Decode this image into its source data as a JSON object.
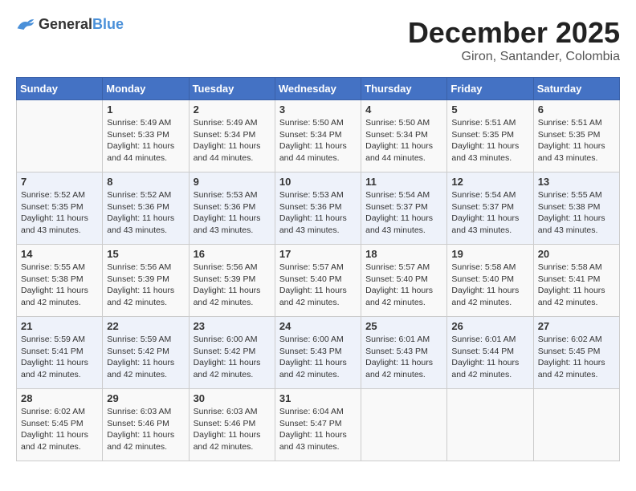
{
  "header": {
    "logo_general": "General",
    "logo_blue": "Blue",
    "month_year": "December 2025",
    "location": "Giron, Santander, Colombia"
  },
  "weekdays": [
    "Sunday",
    "Monday",
    "Tuesday",
    "Wednesday",
    "Thursday",
    "Friday",
    "Saturday"
  ],
  "weeks": [
    [
      {
        "day": "",
        "info": ""
      },
      {
        "day": "1",
        "info": "Sunrise: 5:49 AM\nSunset: 5:33 PM\nDaylight: 11 hours\nand 44 minutes."
      },
      {
        "day": "2",
        "info": "Sunrise: 5:49 AM\nSunset: 5:34 PM\nDaylight: 11 hours\nand 44 minutes."
      },
      {
        "day": "3",
        "info": "Sunrise: 5:50 AM\nSunset: 5:34 PM\nDaylight: 11 hours\nand 44 minutes."
      },
      {
        "day": "4",
        "info": "Sunrise: 5:50 AM\nSunset: 5:34 PM\nDaylight: 11 hours\nand 44 minutes."
      },
      {
        "day": "5",
        "info": "Sunrise: 5:51 AM\nSunset: 5:35 PM\nDaylight: 11 hours\nand 43 minutes."
      },
      {
        "day": "6",
        "info": "Sunrise: 5:51 AM\nSunset: 5:35 PM\nDaylight: 11 hours\nand 43 minutes."
      }
    ],
    [
      {
        "day": "7",
        "info": "Sunrise: 5:52 AM\nSunset: 5:35 PM\nDaylight: 11 hours\nand 43 minutes."
      },
      {
        "day": "8",
        "info": "Sunrise: 5:52 AM\nSunset: 5:36 PM\nDaylight: 11 hours\nand 43 minutes."
      },
      {
        "day": "9",
        "info": "Sunrise: 5:53 AM\nSunset: 5:36 PM\nDaylight: 11 hours\nand 43 minutes."
      },
      {
        "day": "10",
        "info": "Sunrise: 5:53 AM\nSunset: 5:36 PM\nDaylight: 11 hours\nand 43 minutes."
      },
      {
        "day": "11",
        "info": "Sunrise: 5:54 AM\nSunset: 5:37 PM\nDaylight: 11 hours\nand 43 minutes."
      },
      {
        "day": "12",
        "info": "Sunrise: 5:54 AM\nSunset: 5:37 PM\nDaylight: 11 hours\nand 43 minutes."
      },
      {
        "day": "13",
        "info": "Sunrise: 5:55 AM\nSunset: 5:38 PM\nDaylight: 11 hours\nand 43 minutes."
      }
    ],
    [
      {
        "day": "14",
        "info": "Sunrise: 5:55 AM\nSunset: 5:38 PM\nDaylight: 11 hours\nand 42 minutes."
      },
      {
        "day": "15",
        "info": "Sunrise: 5:56 AM\nSunset: 5:39 PM\nDaylight: 11 hours\nand 42 minutes."
      },
      {
        "day": "16",
        "info": "Sunrise: 5:56 AM\nSunset: 5:39 PM\nDaylight: 11 hours\nand 42 minutes."
      },
      {
        "day": "17",
        "info": "Sunrise: 5:57 AM\nSunset: 5:40 PM\nDaylight: 11 hours\nand 42 minutes."
      },
      {
        "day": "18",
        "info": "Sunrise: 5:57 AM\nSunset: 5:40 PM\nDaylight: 11 hours\nand 42 minutes."
      },
      {
        "day": "19",
        "info": "Sunrise: 5:58 AM\nSunset: 5:40 PM\nDaylight: 11 hours\nand 42 minutes."
      },
      {
        "day": "20",
        "info": "Sunrise: 5:58 AM\nSunset: 5:41 PM\nDaylight: 11 hours\nand 42 minutes."
      }
    ],
    [
      {
        "day": "21",
        "info": "Sunrise: 5:59 AM\nSunset: 5:41 PM\nDaylight: 11 hours\nand 42 minutes."
      },
      {
        "day": "22",
        "info": "Sunrise: 5:59 AM\nSunset: 5:42 PM\nDaylight: 11 hours\nand 42 minutes."
      },
      {
        "day": "23",
        "info": "Sunrise: 6:00 AM\nSunset: 5:42 PM\nDaylight: 11 hours\nand 42 minutes."
      },
      {
        "day": "24",
        "info": "Sunrise: 6:00 AM\nSunset: 5:43 PM\nDaylight: 11 hours\nand 42 minutes."
      },
      {
        "day": "25",
        "info": "Sunrise: 6:01 AM\nSunset: 5:43 PM\nDaylight: 11 hours\nand 42 minutes."
      },
      {
        "day": "26",
        "info": "Sunrise: 6:01 AM\nSunset: 5:44 PM\nDaylight: 11 hours\nand 42 minutes."
      },
      {
        "day": "27",
        "info": "Sunrise: 6:02 AM\nSunset: 5:45 PM\nDaylight: 11 hours\nand 42 minutes."
      }
    ],
    [
      {
        "day": "28",
        "info": "Sunrise: 6:02 AM\nSunset: 5:45 PM\nDaylight: 11 hours\nand 42 minutes."
      },
      {
        "day": "29",
        "info": "Sunrise: 6:03 AM\nSunset: 5:46 PM\nDaylight: 11 hours\nand 42 minutes."
      },
      {
        "day": "30",
        "info": "Sunrise: 6:03 AM\nSunset: 5:46 PM\nDaylight: 11 hours\nand 42 minutes."
      },
      {
        "day": "31",
        "info": "Sunrise: 6:04 AM\nSunset: 5:47 PM\nDaylight: 11 hours\nand 43 minutes."
      },
      {
        "day": "",
        "info": ""
      },
      {
        "day": "",
        "info": ""
      },
      {
        "day": "",
        "info": ""
      }
    ]
  ]
}
